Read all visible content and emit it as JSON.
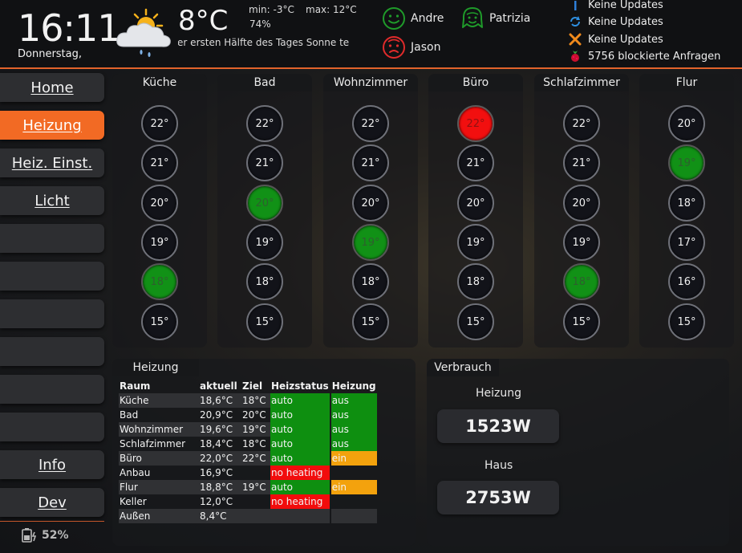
{
  "header": {
    "time": "16:11",
    "date": "Donnerstag,",
    "weather": {
      "icon": "partly-cloudy-rain-icon",
      "temperature": "8°C",
      "min": "min: -3°C",
      "max": "max: 12°C",
      "humidity": "74%",
      "forecast": "d der ersten Hälfte des Tages Sonne te"
    },
    "persons": [
      {
        "name": "Andre",
        "icon": "face-smile-icon",
        "color": "#1f9b2a"
      },
      {
        "name": "Patrizia",
        "icon": "face-woman-icon",
        "color": "#1f9b2a"
      },
      {
        "name": "Jason",
        "icon": "face-sad-icon",
        "color": "#e02b2b"
      }
    ],
    "status": [
      {
        "text": "Keine Updates",
        "icon": "blue-arrow-icon"
      },
      {
        "text": "Keine Updates",
        "icon": "blue-sync-icon"
      },
      {
        "text": "Keine Updates",
        "icon": "orange-x-icon"
      },
      {
        "text": "5756 blockierte Anfragen",
        "icon": "raspberry-icon"
      }
    ]
  },
  "nav": {
    "items": [
      {
        "label": "Home",
        "active": false
      },
      {
        "label": "Heizung",
        "active": true
      },
      {
        "label": "Heiz. Einst.",
        "active": false
      },
      {
        "label": "Licht",
        "active": false
      },
      {
        "label": "",
        "active": false
      },
      {
        "label": "",
        "active": false
      },
      {
        "label": "",
        "active": false
      },
      {
        "label": "",
        "active": false
      },
      {
        "label": "",
        "active": false
      },
      {
        "label": "",
        "active": false
      },
      {
        "label": "Info",
        "active": false
      },
      {
        "label": "Dev",
        "active": false
      }
    ],
    "battery": "52%"
  },
  "rooms": [
    {
      "name": "Küche",
      "temps": [
        "22°",
        "21°",
        "20°",
        "19°",
        "18°",
        "15°"
      ],
      "selected": 4,
      "alert": -1
    },
    {
      "name": "Bad",
      "temps": [
        "22°",
        "21°",
        "20°",
        "19°",
        "18°",
        "15°"
      ],
      "selected": 2,
      "alert": -1
    },
    {
      "name": "Wohnzimmer",
      "temps": [
        "22°",
        "21°",
        "20°",
        "19°",
        "18°",
        "15°"
      ],
      "selected": 3,
      "alert": -1
    },
    {
      "name": "Büro",
      "temps": [
        "22°",
        "21°",
        "20°",
        "19°",
        "18°",
        "15°"
      ],
      "selected": -1,
      "alert": 0
    },
    {
      "name": "Schlafzimmer",
      "temps": [
        "22°",
        "21°",
        "20°",
        "19°",
        "18°",
        "15°"
      ],
      "selected": 4,
      "alert": -1
    },
    {
      "name": "Flur",
      "temps": [
        "20°",
        "19°",
        "18°",
        "17°",
        "16°",
        "15°"
      ],
      "selected": 1,
      "alert": -1
    }
  ],
  "heizung": {
    "title": "Heizung",
    "columns": [
      "Raum",
      "aktuell",
      "Ziel",
      "Heizstatus",
      "Heizung"
    ],
    "rows": [
      {
        "raum": "Küche",
        "aktuell": "18,6°C",
        "ziel": "18°C",
        "status": "auto",
        "status_color": "green",
        "heizung": "aus",
        "heizung_color": "green"
      },
      {
        "raum": "Bad",
        "aktuell": "20,9°C",
        "ziel": "20°C",
        "status": "auto",
        "status_color": "green",
        "heizung": "aus",
        "heizung_color": "green"
      },
      {
        "raum": "Wohnzimmer",
        "aktuell": "19,6°C",
        "ziel": "19°C",
        "status": "auto",
        "status_color": "green",
        "heizung": "aus",
        "heizung_color": "green"
      },
      {
        "raum": "Schlafzimmer",
        "aktuell": "18,4°C",
        "ziel": "18°C",
        "status": "auto",
        "status_color": "green",
        "heizung": "aus",
        "heizung_color": "green"
      },
      {
        "raum": "Büro",
        "aktuell": "22,0°C",
        "ziel": "22°C",
        "status": "auto",
        "status_color": "green",
        "heizung": "ein",
        "heizung_color": "orange"
      },
      {
        "raum": "Anbau",
        "aktuell": "16,9°C",
        "ziel": "",
        "status": "no heating",
        "status_color": "red",
        "heizung": "",
        "heizung_color": ""
      },
      {
        "raum": "Flur",
        "aktuell": "18,8°C",
        "ziel": "19°C",
        "status": "auto",
        "status_color": "green",
        "heizung": "ein",
        "heizung_color": "orange"
      },
      {
        "raum": "Keller",
        "aktuell": "12,0°C",
        "ziel": "",
        "status": "no heating",
        "status_color": "red",
        "heizung": "",
        "heizung_color": ""
      },
      {
        "raum": "Außen",
        "aktuell": "8,4°C",
        "ziel": "",
        "status": "",
        "status_color": "",
        "heizung": "",
        "heizung_color": ""
      }
    ],
    "colors": {
      "green": "#0e8f10",
      "red": "#f20c0c",
      "orange": "#f3a20d"
    }
  },
  "verbrauch": {
    "title": "Verbrauch",
    "items": [
      {
        "label": "Heizung",
        "value": "1523W"
      },
      {
        "label": "Haus",
        "value": "2753W"
      }
    ]
  },
  "colors": {
    "accent": "#f26a24",
    "panel": "#1a1b1e",
    "selected": "#119116",
    "alert": "#f20f0f"
  }
}
